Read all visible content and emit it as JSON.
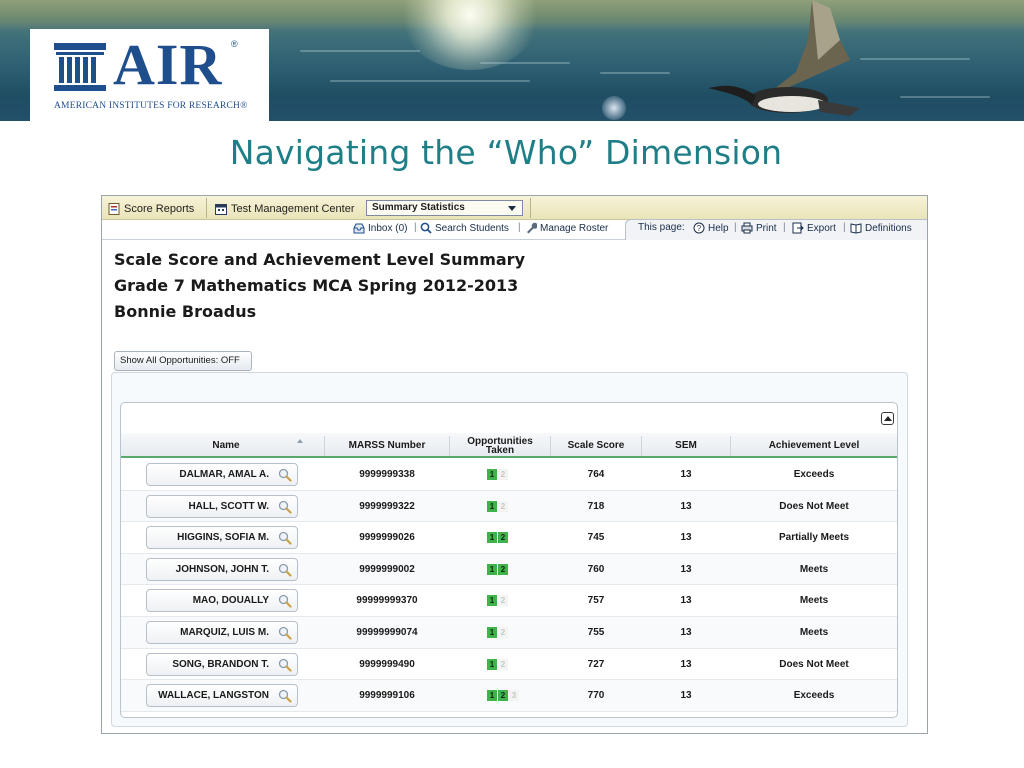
{
  "slide": {
    "logo_word": "AIR",
    "logo_reg": "®",
    "logo_subtitle": "AMERICAN INSTITUTES FOR RESEARCH®",
    "title": "Navigating the “Who” Dimension"
  },
  "app": {
    "tabs": [
      {
        "label": "Score Reports",
        "icon": "score-reports-icon"
      },
      {
        "label": "Test Management Center",
        "icon": "calendar-icon"
      }
    ],
    "report_select": "Summary Statistics",
    "links": {
      "inbox": "Inbox (0)",
      "search": "Search Students",
      "manage": "Manage Roster",
      "this_page": "This page:",
      "help": "Help",
      "print": "Print",
      "export": "Export",
      "definitions": "Definitions"
    },
    "divider": "|"
  },
  "report": {
    "title": "Scale Score and Achievement Level Summary",
    "subtitle": "Grade 7 Mathematics MCA Spring 2012-2013",
    "teacher": "Bonnie Broadus",
    "toggle_label": "Show All Opportunities: OFF"
  },
  "table": {
    "headers": {
      "name": "Name",
      "marss": "MARSS Number",
      "opps_line1": "Opportunities",
      "opps_line2": "Taken",
      "scale": "Scale Score",
      "sem": "SEM",
      "level": "Achievement Level"
    },
    "rows": [
      {
        "name": "DALMAR, AMAL A.",
        "marss": "9999999338",
        "opps": [
          {
            "n": "1",
            "on": true
          },
          {
            "n": "2",
            "on": false
          }
        ],
        "scale": "764",
        "sem": "13",
        "level": "Exceeds"
      },
      {
        "name": "HALL, SCOTT W.",
        "marss": "9999999322",
        "opps": [
          {
            "n": "1",
            "on": true
          },
          {
            "n": "2",
            "on": false
          }
        ],
        "scale": "718",
        "sem": "13",
        "level": "Does Not Meet"
      },
      {
        "name": "HIGGINS, SOFIA M.",
        "marss": "9999999026",
        "opps": [
          {
            "n": "1",
            "on": true
          },
          {
            "n": "2",
            "on": true
          }
        ],
        "scale": "745",
        "sem": "13",
        "level": "Partially Meets"
      },
      {
        "name": "JOHNSON, JOHN T.",
        "marss": "9999999002",
        "opps": [
          {
            "n": "1",
            "on": true
          },
          {
            "n": "2",
            "on": true
          }
        ],
        "scale": "760",
        "sem": "13",
        "level": "Meets"
      },
      {
        "name": "MAO, DOUALLY",
        "marss": "99999999370",
        "opps": [
          {
            "n": "1",
            "on": true
          },
          {
            "n": "2",
            "on": false
          }
        ],
        "scale": "757",
        "sem": "13",
        "level": "Meets"
      },
      {
        "name": "MARQUIZ, LUIS M.",
        "marss": "99999999074",
        "opps": [
          {
            "n": "1",
            "on": true
          },
          {
            "n": "2",
            "on": false
          }
        ],
        "scale": "755",
        "sem": "13",
        "level": "Meets"
      },
      {
        "name": "SONG, BRANDON T.",
        "marss": "9999999490",
        "opps": [
          {
            "n": "1",
            "on": true
          },
          {
            "n": "2",
            "on": false
          }
        ],
        "scale": "727",
        "sem": "13",
        "level": "Does Not Meet"
      },
      {
        "name": "WALLACE, LANGSTON",
        "marss": "9999999106",
        "opps": [
          {
            "n": "1",
            "on": true
          },
          {
            "n": "2",
            "on": true
          },
          {
            "n": "3",
            "on": false
          }
        ],
        "scale": "770",
        "sem": "13",
        "level": "Exceeds"
      }
    ]
  },
  "colors": {
    "title_teal": "#1f7f86",
    "air_blue": "#1f4e8c",
    "opp_green": "#3fb24a",
    "header_rule": "#57a86a"
  }
}
